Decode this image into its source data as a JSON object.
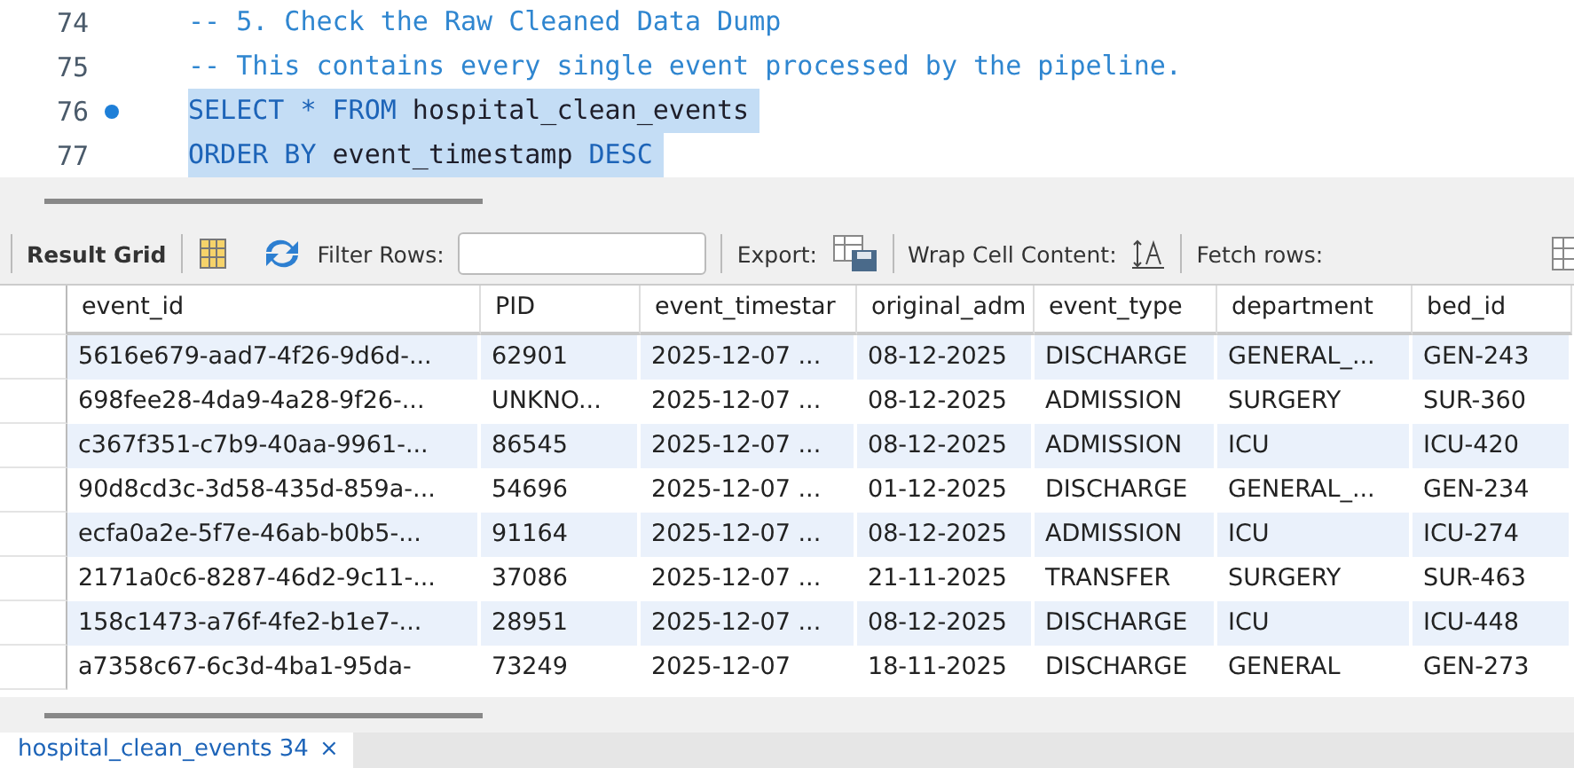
{
  "editor": {
    "lines": [
      {
        "number": "74",
        "marker": false,
        "selected": false,
        "tokens": [
          {
            "kind": "comment",
            "text": "-- 5. Check the Raw Cleaned Data Dump"
          }
        ]
      },
      {
        "number": "75",
        "marker": false,
        "selected": false,
        "tokens": [
          {
            "kind": "comment",
            "text": "-- This contains every single event processed by the pipeline."
          }
        ]
      },
      {
        "number": "76",
        "marker": true,
        "selected": true,
        "tokens": [
          {
            "kind": "keyword",
            "text": "SELECT * FROM"
          },
          {
            "kind": "plain",
            "text": " hospital_clean_events"
          }
        ]
      },
      {
        "number": "77",
        "marker": false,
        "selected": true,
        "tokens": [
          {
            "kind": "keyword",
            "text": "ORDER BY"
          },
          {
            "kind": "plain",
            "text": " event_timestamp "
          },
          {
            "kind": "keyword",
            "text": "DESC"
          }
        ]
      }
    ]
  },
  "toolbar": {
    "result_grid": "Result Grid",
    "filter_label": "Filter Rows:",
    "export_label": "Export:",
    "wrap_label": "Wrap Cell Content:",
    "fetch_label": "Fetch rows:"
  },
  "table": {
    "columns": [
      "event_id",
      "PID",
      "event_timestar",
      "original_adm",
      "event_type",
      "department",
      "bed_id"
    ],
    "rows": [
      [
        "5616e679-aad7-4f26-9d6d-...",
        "62901",
        "2025-12-07 ...",
        "08-12-2025",
        "DISCHARGE",
        "GENERAL_...",
        "GEN-243"
      ],
      [
        "698fee28-4da9-4a28-9f26-...",
        "UNKNO...",
        "2025-12-07 ...",
        "08-12-2025",
        "ADMISSION",
        "SURGERY",
        "SUR-360"
      ],
      [
        "c367f351-c7b9-40aa-9961-...",
        "86545",
        "2025-12-07 ...",
        "08-12-2025",
        "ADMISSION",
        "ICU",
        "ICU-420"
      ],
      [
        "90d8cd3c-3d58-435d-859a-...",
        "54696",
        "2025-12-07 ...",
        "01-12-2025",
        "DISCHARGE",
        "GENERAL_...",
        "GEN-234"
      ],
      [
        "ecfa0a2e-5f7e-46ab-b0b5-...",
        "91164",
        "2025-12-07 ...",
        "08-12-2025",
        "ADMISSION",
        "ICU",
        "ICU-274"
      ],
      [
        "2171a0c6-8287-46d2-9c11-...",
        "37086",
        "2025-12-07 ...",
        "21-11-2025",
        "TRANSFER",
        "SURGERY",
        "SUR-463"
      ],
      [
        "158c1473-a76f-4fe2-b1e7-...",
        "28951",
        "2025-12-07 ...",
        "08-12-2025",
        "DISCHARGE",
        "ICU",
        "ICU-448"
      ],
      [
        "a7358c67-6c3d-4ba1-95da-",
        "73249",
        "2025-12-07",
        "18-11-2025",
        "DISCHARGE",
        "GENERAL",
        "GEN-273"
      ]
    ]
  },
  "result_tab": {
    "label": "hospital_clean_events 34",
    "close": "×"
  }
}
